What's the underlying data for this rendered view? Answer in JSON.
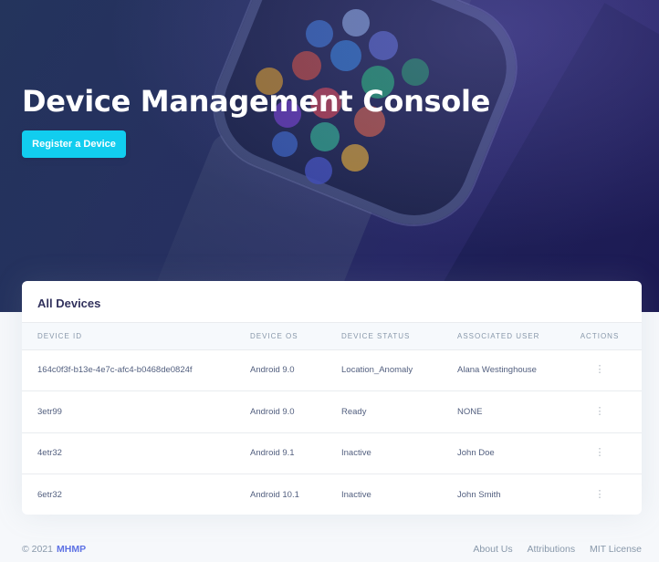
{
  "header": {
    "title": "Device Management Console",
    "register_button_label": "Register a Device"
  },
  "devices_card": {
    "title": "All Devices",
    "columns": [
      "Device ID",
      "Device OS",
      "Device Status",
      "Associated User",
      "Actions"
    ],
    "rows": [
      {
        "device_id": "164c0f3f-b13e-4e7c-afc4-b0468de0824f",
        "os": "Android 9.0",
        "status": "Location_Anomaly",
        "user": "Alana Westinghouse",
        "actions_icon": "⋮"
      },
      {
        "device_id": "3etr99",
        "os": "Android 9.0",
        "status": "Ready",
        "user": "NONE",
        "actions_icon": "⋮"
      },
      {
        "device_id": "4etr32",
        "os": "Android 9.1",
        "status": "Inactive",
        "user": "John Doe",
        "actions_icon": "⋮"
      },
      {
        "device_id": "6etr32",
        "os": "Android 10.1",
        "status": "Inactive",
        "user": "John Smith",
        "actions_icon": "⋮"
      }
    ]
  },
  "footer": {
    "copyright": "© 2021",
    "brand": "MHMP",
    "links": [
      "About Us",
      "Attributions",
      "MIT License"
    ]
  },
  "colors": {
    "accent_button": "#11cdef",
    "brand_link": "#5e72e4",
    "hero_background": "#2c3566"
  }
}
